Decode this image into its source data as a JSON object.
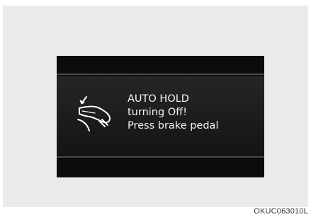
{
  "display": {
    "message_lines": [
      "AUTO HOLD",
      "turning Off!",
      "Press brake pedal"
    ],
    "icon": "brake-pedal-press-icon"
  },
  "figure_code": "OKUC063010L",
  "colors": {
    "background": "#ebebeb",
    "display_bg": "#121212",
    "text": "#f4f4f4"
  }
}
